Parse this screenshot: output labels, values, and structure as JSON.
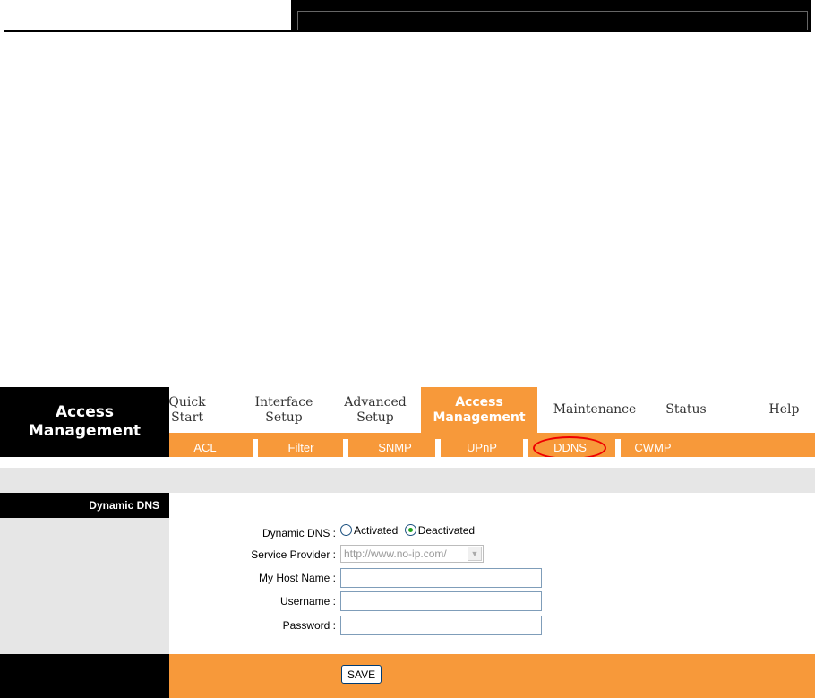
{
  "header": {
    "brand_line1": "Access",
    "brand_line2": "Management"
  },
  "main_nav": {
    "quick_start": [
      "Quick",
      "Start"
    ],
    "interface_setup": [
      "Interface",
      "Setup"
    ],
    "advanced_setup": [
      "Advanced",
      "Setup"
    ],
    "access_management": [
      "Access",
      "Management"
    ],
    "maintenance": "Maintenance",
    "status": "Status",
    "help": "Help",
    "active": "access_management"
  },
  "sub_nav": {
    "items": [
      "ACL",
      "Filter",
      "SNMP",
      "UPnP",
      "DDNS",
      "CWMP"
    ],
    "active": "DDNS"
  },
  "section": {
    "title": "Dynamic DNS"
  },
  "form": {
    "dynamic_dns_label": "Dynamic DNS :",
    "activated_label": "Activated",
    "deactivated_label": "Deactivated",
    "selected": "Deactivated",
    "service_provider_label": "Service Provider :",
    "service_provider_value": "http://www.no-ip.com/",
    "host_name_label": "My Host Name :",
    "host_name_value": "",
    "username_label": "Username :",
    "username_value": "",
    "password_label": "Password :",
    "password_value": ""
  },
  "footer": {
    "save_label": "SAVE"
  },
  "colors": {
    "orange": "#f7993a",
    "black": "#000000",
    "grey": "#e6e6e6",
    "highlight_ring": "#e00000"
  }
}
